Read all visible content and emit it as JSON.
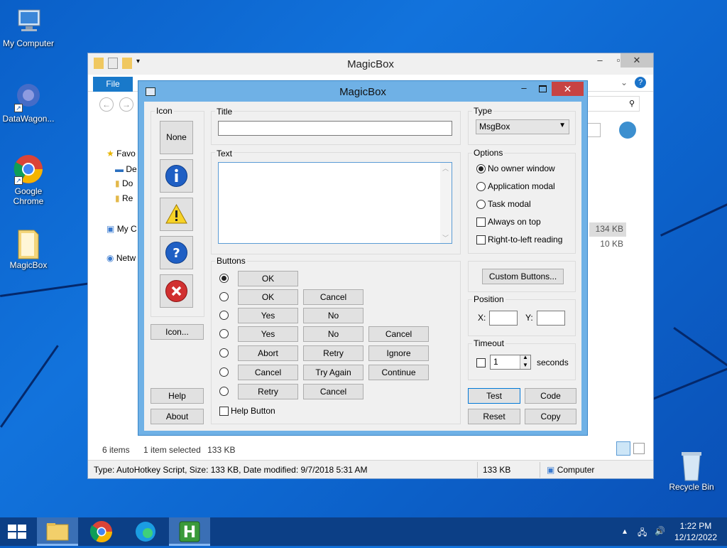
{
  "desktop": {
    "icons": [
      {
        "label": "My Computer"
      },
      {
        "label": "DataWagon..."
      },
      {
        "label": "Google Chrome"
      },
      {
        "label": "MagicBox"
      },
      {
        "label": "Recycle Bin"
      }
    ]
  },
  "explorer": {
    "title": "MagicBox",
    "file_tab": "File",
    "sidebar": [
      "Favo",
      "De",
      "Do",
      "Re",
      "My C",
      "Netw"
    ],
    "file_sizes": [
      "134 KB",
      "10 KB"
    ],
    "status": {
      "items": "6 items",
      "selected": "1 item selected",
      "selected_size": "133 KB",
      "details": "Type: AutoHotkey Script, Size: 133 KB, Date modified: 9/7/2018 5:31 AM",
      "size": "133 KB",
      "location": "Computer"
    }
  },
  "dialog": {
    "title": "MagicBox",
    "icon_group": {
      "label": "Icon",
      "none_label": "None",
      "icon_button": "Icon...",
      "help": "Help",
      "about": "About"
    },
    "title_group": {
      "label": "Title",
      "value": ""
    },
    "text_group": {
      "label": "Text",
      "value": ""
    },
    "type_group": {
      "label": "Type",
      "selected": "MsgBox"
    },
    "options": {
      "label": "Options",
      "radios": [
        "No owner window",
        "Application modal",
        "Task modal"
      ],
      "checks": [
        "Always on top",
        "Right-to-left reading"
      ],
      "selected_radio": "No owner window"
    },
    "buttons_group": {
      "label": "Buttons",
      "rows": [
        [
          "OK"
        ],
        [
          "OK",
          "Cancel"
        ],
        [
          "Yes",
          "No"
        ],
        [
          "Yes",
          "No",
          "Cancel"
        ],
        [
          "Abort",
          "Retry",
          "Ignore"
        ],
        [
          "Cancel",
          "Try Again",
          "Continue"
        ],
        [
          "Retry",
          "Cancel"
        ]
      ],
      "help_button": "Help Button"
    },
    "custom_buttons": "Custom Buttons...",
    "position": {
      "label": "Position",
      "x_label": "X:",
      "y_label": "Y:",
      "x": "",
      "y": ""
    },
    "timeout": {
      "label": "Timeout",
      "value": "1",
      "unit": "seconds"
    },
    "actions": {
      "test": "Test",
      "code": "Code",
      "reset": "Reset",
      "copy": "Copy"
    }
  },
  "taskbar": {
    "time": "1:22 PM",
    "date": "12/12/2022"
  }
}
